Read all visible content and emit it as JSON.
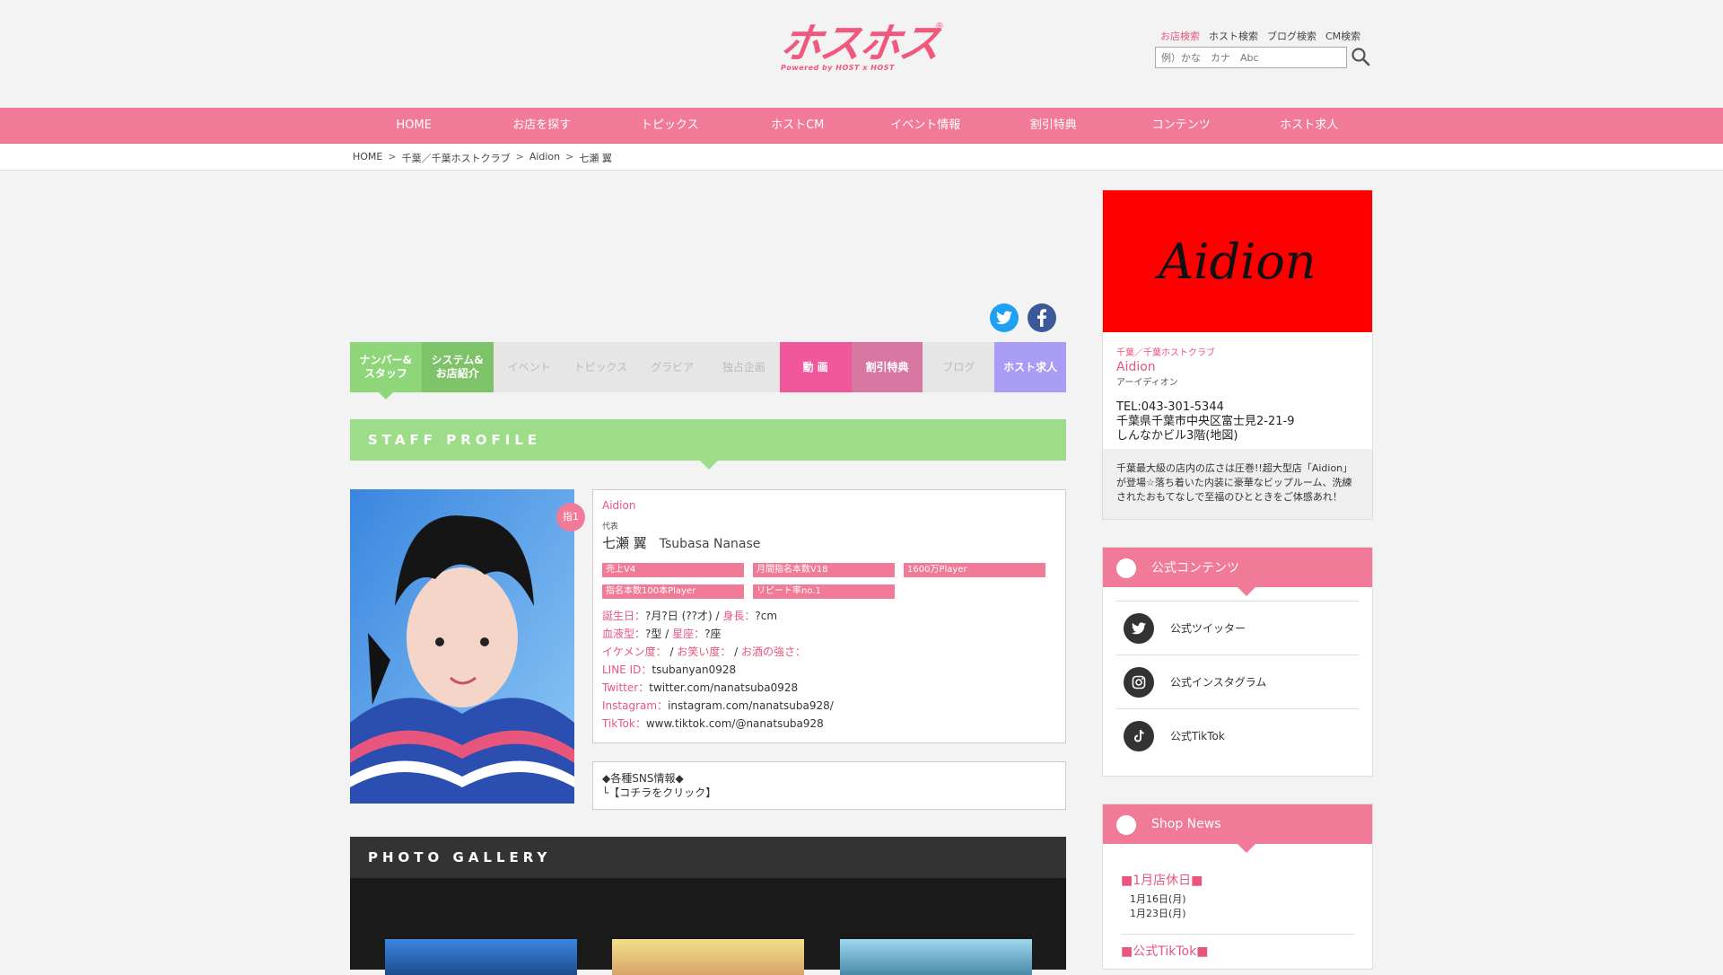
{
  "header": {
    "logo_text": "ホスホス",
    "logo_sub": "Powered by HOST x HOST",
    "logo_reg": "®",
    "search_tabs": [
      "お店検索",
      "ホスト検索",
      "ブログ検索",
      "CM検索"
    ],
    "search_placeholder": "例）かな　カナ　Abc"
  },
  "nav": [
    "HOME",
    "お店を探す",
    "トピックス",
    "ホストCM",
    "イベント情報",
    "割引特典",
    "コンテンツ",
    "ホスト求人"
  ],
  "breadcrumb": [
    "HOME",
    "千葉／千葉ホストクラブ",
    "Aidion",
    "七瀬 翼"
  ],
  "breadcrumb_sep": ">",
  "shop_tabs": [
    {
      "label": "ナンバー&\nスタッフ",
      "color": "#8fd67a",
      "enabled": true
    },
    {
      "label": "システム&\nお店紹介",
      "color": "#7ec26a",
      "enabled": true
    },
    {
      "label": "イベント",
      "color": "#e6e6e6",
      "enabled": false
    },
    {
      "label": "トピックス",
      "color": "#e6e6e6",
      "enabled": false
    },
    {
      "label": "グラビア",
      "color": "#e6e6e6",
      "enabled": false
    },
    {
      "label": "独占企画",
      "color": "#e6e6e6",
      "enabled": false
    },
    {
      "label": "動 画",
      "color": "#f0589b",
      "enabled": true
    },
    {
      "label": "割引特典",
      "color": "#d977a3",
      "enabled": true
    },
    {
      "label": "ブログ",
      "color": "#e6e6e6",
      "enabled": false
    },
    {
      "label": "ホスト求人",
      "color": "#a99cf5",
      "enabled": true
    }
  ],
  "staff_profile_heading": "STAFF PROFILE",
  "profile": {
    "shop": "Aidion",
    "role": "代表",
    "name": "七瀬 翼",
    "name_en": "Tsubasa Nanase",
    "badge": "指1",
    "tags": [
      "売上V4",
      "月間指名本数V18",
      "1600万Player",
      "指名本数100本Player",
      "リピート率no.1"
    ],
    "birthday_label": "誕生日：",
    "birthday": "?月?日 (??才)",
    "height_label": "身長：",
    "height": "?cm",
    "blood_label": "血液型：",
    "blood": "?型",
    "sign_label": "星座：",
    "sign": "?座",
    "ikemen_label": "イケメン度：",
    "owarai_label": "お笑い度：",
    "sake_label": "お酒の強さ：",
    "line_label": "LINE ID：",
    "line": "tsubanyan0928",
    "twitter_label": "Twitter：",
    "twitter": "twitter.com/nanatsuba0928",
    "instagram_label": "Instagram：",
    "instagram": "instagram.com/nanatsuba928/",
    "tiktok_label": "TikTok：",
    "tiktok": "www.tiktok.com/@nanatsuba928"
  },
  "sns_box": {
    "line1": "◆各種SNS情報◆",
    "line2": "└【コチラをクリック】"
  },
  "gallery_heading": "PHOTO GALLERY",
  "shop_card": {
    "logo_text": "Aidion",
    "area": "千葉／千葉ホストクラブ",
    "name": "Aidion",
    "kana": "アーイディオン",
    "tel": "TEL:043-301-5344",
    "address": "千葉県千葉市中央区富士見2-21-9",
    "building": "しんなかビル3階(地図)",
    "description": "千葉最大級の店内の広さは圧巻!!超大型店「Aidion」が登場☆落ち着いた内装に豪華なビップルーム、洗練されたおもてなしで至福のひとときをご体感あれ！"
  },
  "official": {
    "title": "公式コンテンツ",
    "items": [
      "公式ツイッター",
      "公式インスタグラム",
      "公式TikTok"
    ]
  },
  "news": {
    "title": "Shop News",
    "item1_title": "■1月店休日■",
    "item1_lines": [
      "1月16日(月)",
      "1月23日(月)"
    ],
    "item2_title": "■公式TikTok■"
  },
  "colors": {
    "accent": "#f07a98",
    "green": "#8fd67a",
    "dark": "#333333",
    "shop_logo_bg": "#ff0000"
  }
}
